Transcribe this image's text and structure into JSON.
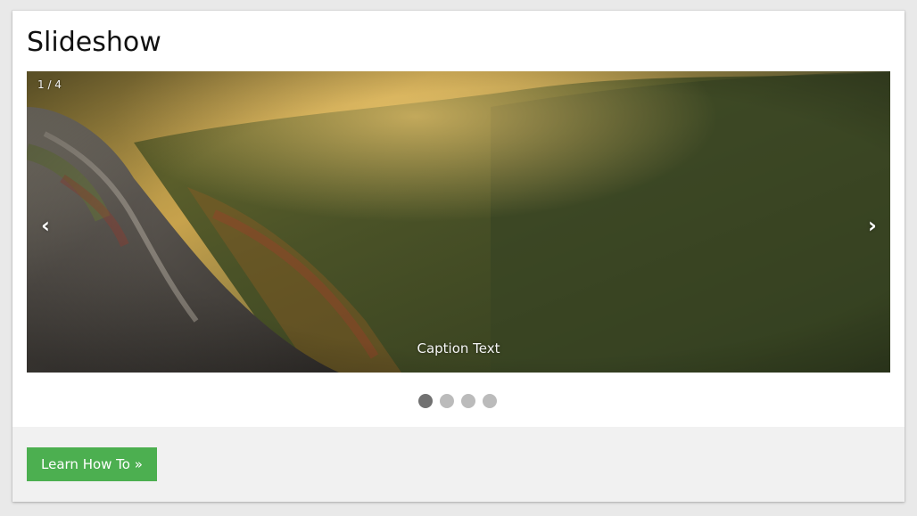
{
  "title": "Slideshow",
  "slideshow": {
    "counter": "1 / 4",
    "current_slide": 1,
    "total_slides": 4,
    "prev_label": "‹",
    "next_label": "›",
    "caption": "Caption Text",
    "dots_count": 4,
    "active_dot": 1,
    "colors": {
      "dot_active": "#717171",
      "dot_inactive": "#bbbbbb"
    }
  },
  "footer": {
    "button_label": "Learn How To »",
    "button_color": "#4caf50",
    "background": "#f1f1f1"
  }
}
